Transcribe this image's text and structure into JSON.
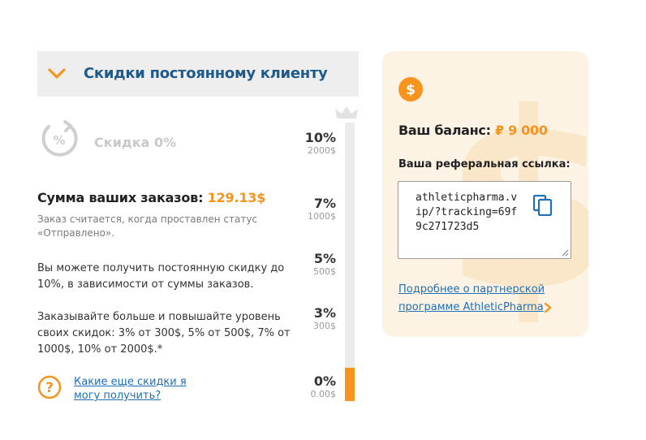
{
  "accordion": {
    "title": "Скидки постоянному клиенту"
  },
  "current_discount": {
    "label": "Скидка 0%"
  },
  "orders": {
    "sum_label": "Сумма ваших заказов:",
    "sum_value": "129.13$",
    "note": "Заказ считается, когда проставлен статус «Отправлено»."
  },
  "info": {
    "para1": "Вы можете получить постоянную скидку до 10%, в зависимости от суммы заказов.",
    "para2": "Заказывайте больше и повышайте уровень своих скидок: 3% от 300$, 5% от 500$, 7% от 1000$, 10% от 2000$.*"
  },
  "more_link": "Какие еще скидки я могу получить?",
  "scale": {
    "levels": [
      {
        "percent": "10%",
        "amount": "2000$"
      },
      {
        "percent": "7%",
        "amount": "1000$"
      },
      {
        "percent": "5%",
        "amount": "500$"
      },
      {
        "percent": "3%",
        "amount": "300$"
      },
      {
        "percent": "0%",
        "amount": "0.00$"
      }
    ],
    "progress_fraction": 0.12
  },
  "balance": {
    "label": "Ваш баланс:",
    "value": "₽ 9 000",
    "ref_label": "Ваша реферальная ссылка:",
    "ref_link": "athleticpharma.vip/?tracking=69f9c271723d5",
    "partner_link": "Подробнее о партнерской программе AthleticPharma"
  },
  "colors": {
    "accent": "#f7941d",
    "title_blue": "#1e5a8a",
    "link": "#1e6fb5",
    "card_bg": "#fdf3e4"
  }
}
